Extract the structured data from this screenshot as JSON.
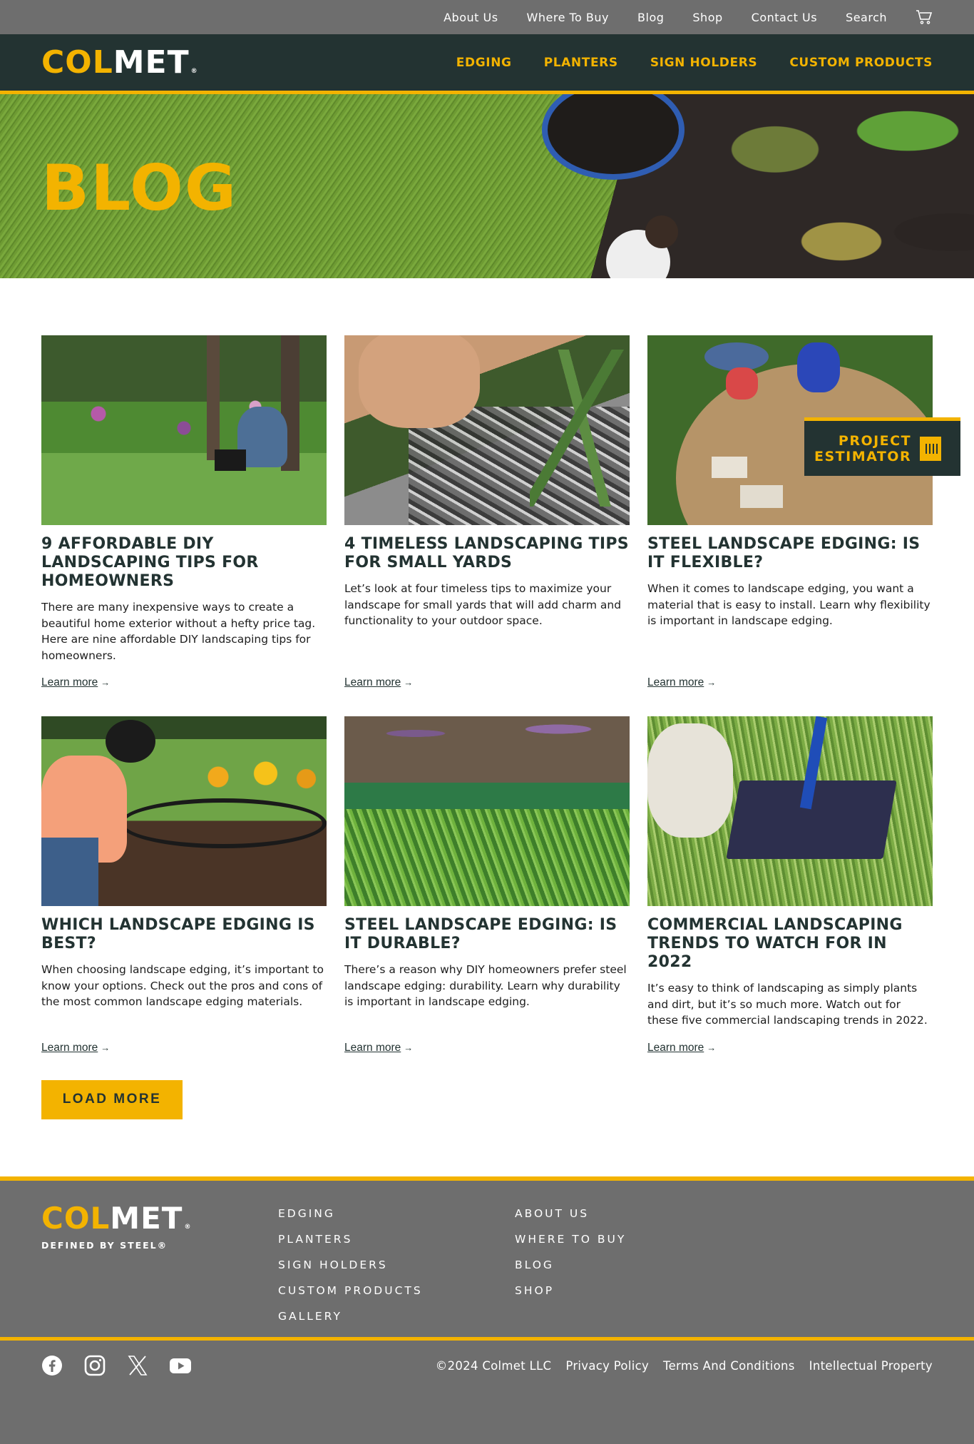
{
  "utility_nav": {
    "items": [
      "About Us",
      "Where To Buy",
      "Blog",
      "Shop",
      "Contact Us",
      "Search"
    ],
    "cart_icon": "cart-icon"
  },
  "header": {
    "logo_part1": "COL",
    "logo_part2": "MET",
    "logo_reg": "®",
    "nav": [
      "EDGING",
      "PLANTERS",
      "SIGN HOLDERS",
      "CUSTOM PRODUCTS"
    ]
  },
  "hero": {
    "title": "BLOG"
  },
  "posts": [
    {
      "title": "9 AFFORDABLE DIY LANDSCAPING TIPS FOR HOMEOWNERS",
      "excerpt": "There are many inexpensive ways to create a beautiful home exterior without a hefty price tag. Here are nine affordable DIY landscaping tips for homeowners.",
      "link": "Learn more"
    },
    {
      "title": "4 TIMELESS LANDSCAPING TIPS FOR SMALL YARDS",
      "excerpt": "Let’s look at four timeless tips to maximize your landscape for small yards that will add charm and functionality to your outdoor space.",
      "link": "Learn more"
    },
    {
      "title": "STEEL LANDSCAPE EDGING: IS IT FLEXIBLE?",
      "excerpt": "When it comes to landscape edging, you want a material that is easy to install. Learn why flexibility is important in landscape edging.",
      "link": "Learn more"
    },
    {
      "title": "WHICH LANDSCAPE EDGING IS BEST?",
      "excerpt": "When choosing landscape edging, it’s important to know your options. Check out the pros and cons of the most common landscape edging materials.",
      "link": "Learn more"
    },
    {
      "title": "STEEL LANDSCAPE EDGING: IS IT DURABLE?",
      "excerpt": "There’s a reason why DIY homeowners prefer steel landscape edging: durability. Learn why durability is important in landscape edging.",
      "link": "Learn more"
    },
    {
      "title": "COMMERCIAL LANDSCAPING TRENDS TO WATCH FOR IN 2022",
      "excerpt": "It’s easy to think of landscaping as simply plants and dirt, but it’s so much more. Watch out for these five commercial landscaping trends in 2022.",
      "link": "Learn more"
    }
  ],
  "estimator": {
    "line1": "PROJECT",
    "line2": "ESTIMATOR"
  },
  "load_more": "LOAD MORE",
  "footer": {
    "logo_part1": "COL",
    "logo_part2": "MET",
    "logo_reg": "®",
    "tagline": "DEFINED BY STEEL®",
    "col1": [
      "EDGING",
      "PLANTERS",
      "SIGN HOLDERS",
      "CUSTOM PRODUCTS",
      "GALLERY"
    ],
    "col2": [
      "ABOUT US",
      "WHERE TO BUY",
      "BLOG",
      "SHOP"
    ],
    "copyright": "©2024 Colmet LLC",
    "legal": [
      "Privacy Policy",
      "Terms And Conditions",
      "Intellectual Property"
    ],
    "social_icons": [
      "facebook-icon",
      "instagram-icon",
      "x-icon",
      "youtube-icon"
    ]
  },
  "colors": {
    "brand_yellow": "#f3b300",
    "dark_green": "#233332",
    "gray": "#6e6e6e"
  }
}
